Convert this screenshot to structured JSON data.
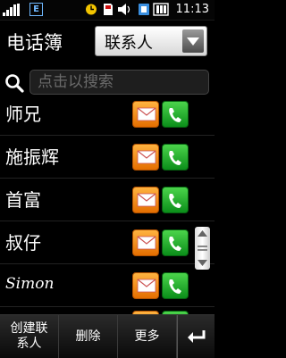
{
  "status_bar": {
    "network_badge": "E",
    "time": "11:13",
    "icons": [
      "signal-icon",
      "alarm-icon",
      "memory-card-icon",
      "volume-icon",
      "sim-icon",
      "battery-icon"
    ]
  },
  "header": {
    "title": "电话簿",
    "dropdown_value": "联系人"
  },
  "search": {
    "placeholder": "点击以搜索"
  },
  "contacts": [
    {
      "name": "师兄"
    },
    {
      "name": "施振辉"
    },
    {
      "name": "首富"
    },
    {
      "name": "叔仔"
    },
    {
      "name": "Simon"
    }
  ],
  "toolbar": {
    "new_contact_label": "创建联系人",
    "delete_label": "删除",
    "more_label": "更多"
  },
  "colors": {
    "message_button": "#f08a10",
    "call_button": "#22b02c",
    "background": "#000000"
  }
}
